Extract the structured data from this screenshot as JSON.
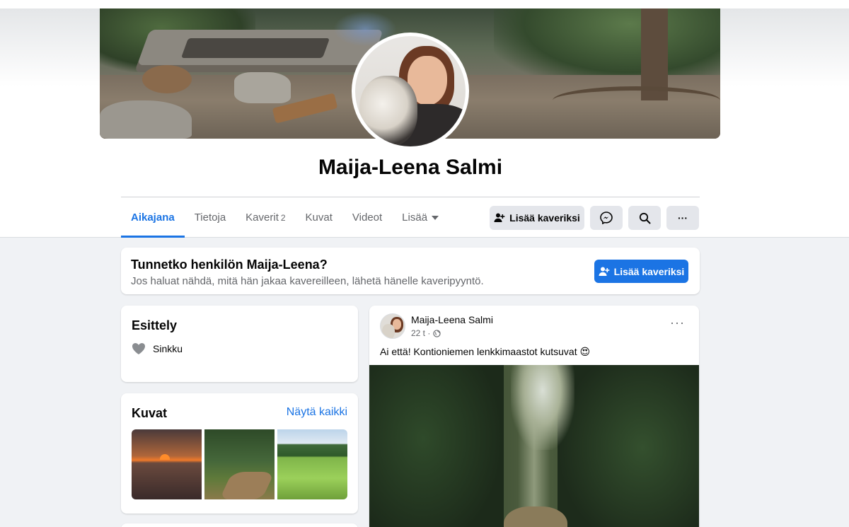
{
  "profile": {
    "name": "Maija-Leena Salmi"
  },
  "tabs": [
    {
      "label": "Aikajana",
      "active": true
    },
    {
      "label": "Tietoja"
    },
    {
      "label": "Kaverit",
      "count": "2"
    },
    {
      "label": "Kuvat"
    },
    {
      "label": "Videot"
    },
    {
      "label": "Lisää"
    }
  ],
  "actions": {
    "add_friend_label": "Lisää kaveriksi",
    "messenger_icon": "messenger-icon",
    "search_icon": "search-icon",
    "more_icon": "more-icon",
    "more_label": "···"
  },
  "know_card": {
    "title": "Tunnetko henkilön Maija-Leena?",
    "subtitle": "Jos haluat nähdä, mitä hän jakaa kavereilleen, lähetä hänelle kaveripyyntö.",
    "button_label": "Lisää kaveriksi"
  },
  "intro": {
    "title": "Esittely",
    "relationship": "Sinkku",
    "relationship_icon": "heart-icon"
  },
  "photos": {
    "title": "Kuvat",
    "see_all": "Näytä kaikki",
    "items": [
      "sunset-photo",
      "forest-path-photo",
      "golf-course-photo"
    ]
  },
  "post": {
    "author": "Maija-Leena Salmi",
    "time": "22 t",
    "privacy_icon": "globe-icon",
    "more_label": "···",
    "text": "Ai että! Kontioniemen lenkkimaastot kutsuvat",
    "emoji": "😍"
  },
  "colors": {
    "accent": "#1b74e4",
    "background": "#f0f2f5",
    "button_gray": "#e4e6eb",
    "secondary_text": "#65676b"
  }
}
